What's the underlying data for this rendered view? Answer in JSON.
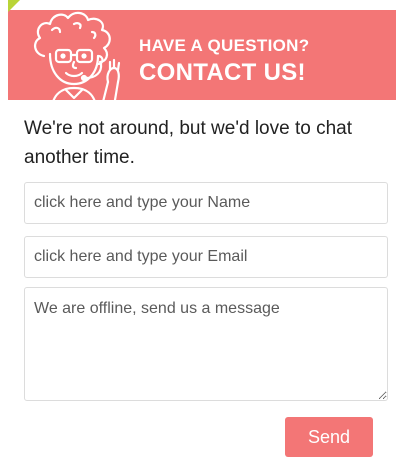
{
  "header": {
    "title_line1": "HAVE A QUESTION?",
    "title_line2": "CONTACT US!",
    "mascot_icon": "cartoon-support-mascot-icon",
    "corner_mark_color": "#b9d437"
  },
  "intro_text": "We're not around, but we'd love to chat another time.",
  "form": {
    "name_placeholder": "click here and type your Name",
    "email_placeholder": "click here and type your Email",
    "message_placeholder": "We are offline, send us a message",
    "send_label": "Send"
  },
  "colors": {
    "accent": "#f37676",
    "accent_text": "#ffffff",
    "body_text": "#222222"
  }
}
